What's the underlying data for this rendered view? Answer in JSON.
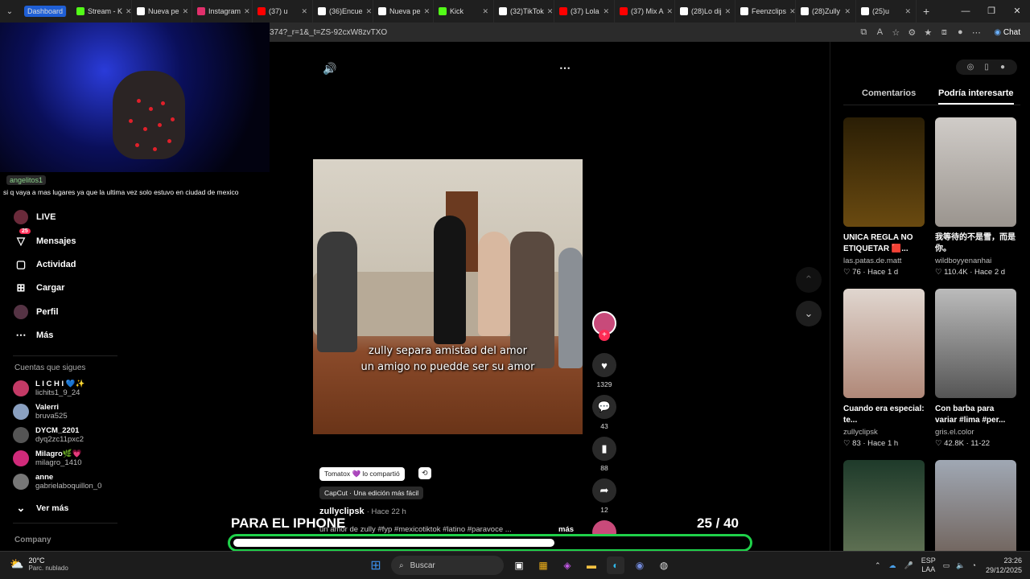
{
  "tabs": [
    {
      "label": "Dashboard",
      "color": "#1f5fd6"
    },
    {
      "label": "Stream - K",
      "color": "#53fc18"
    },
    {
      "label": "Nueva pe",
      "color": "#ffffff"
    },
    {
      "label": "Instagram",
      "color": "#e1306c"
    },
    {
      "label": "(37) u",
      "color": "#ff0000"
    },
    {
      "label": "(36)Encue",
      "color": "#ffffff"
    },
    {
      "label": "Nueva pe",
      "color": "#ffffff"
    },
    {
      "label": "Kick",
      "color": "#53fc18"
    },
    {
      "label": "(32)TikTok",
      "color": "#ffffff"
    },
    {
      "label": "(37) Lola",
      "color": "#ff0000"
    },
    {
      "label": "(37) Mix A",
      "color": "#ff0000"
    },
    {
      "label": "(28)Lo dij",
      "color": "#ffffff"
    },
    {
      "label": "Feenzclips",
      "color": "#ffffff"
    },
    {
      "label": "(28)Zully",
      "color": "#ffffff"
    },
    {
      "label": "(25)u",
      "color": "#ffffff"
    }
  ],
  "address": {
    "url": "374?_r=1&_t=ZS-92cxW8zvTXO",
    "chat_label": "Chat"
  },
  "stream_chat": {
    "user": "angelitos1",
    "message": "si q vaya a mas lugares ya que la ultima vez solo estuvo en ciudad de mexico"
  },
  "sidebar": {
    "nav": [
      {
        "label": "LIVE",
        "icon": "live-icon"
      },
      {
        "label": "Mensajes",
        "icon": "messages-icon",
        "badge": "25"
      },
      {
        "label": "Actividad",
        "icon": "activity-icon"
      },
      {
        "label": "Cargar",
        "icon": "upload-icon"
      },
      {
        "label": "Perfil",
        "icon": "profile-icon"
      },
      {
        "label": "Más",
        "icon": "more-icon"
      }
    ],
    "following_title": "Cuentas que sigues",
    "following": [
      {
        "name": "L I C H I 💙✨",
        "handle": "lichits1_9_24",
        "color": "#c43a66"
      },
      {
        "name": "Valerri",
        "handle": "bruva525",
        "color": "#8aa0c0"
      },
      {
        "name": "DYCM_2201",
        "handle": "dyq2zc11pxc2",
        "color": "#555555"
      },
      {
        "name": "Milagro🌿💗",
        "handle": "milagro_1410",
        "color": "#d02a7a"
      },
      {
        "name": "anne",
        "handle": "gabrielaboquillon_0",
        "color": "#777777"
      }
    ],
    "see_more": "Ver más",
    "company": "Company"
  },
  "video": {
    "subtitle_line1": "zully separa amistad del amor",
    "subtitle_line2": "un amigo no puedde ser su amor",
    "shared_by": "Tomatox 💜 lo compartió",
    "capcut": "CapCut · Una edición más fácil",
    "author": "zullyclipsk",
    "time_ago": "· Hace 22 h",
    "caption": "un amor de zully #fyp #mexicotiktok #latino #paravoce ...",
    "more": "más",
    "likes": "1329",
    "comments": "43",
    "saves": "88",
    "shares": "12"
  },
  "overlay": {
    "title": "PARA EL IPHONE",
    "count": "25",
    "total": "/ 40",
    "progress": 0.625,
    "accent": "#1fd14a"
  },
  "right_panel": {
    "tabs": [
      "Comentarios",
      "Podría interesarte"
    ],
    "cards": [
      {
        "title": "UNICA REGLA NO ETIQUETAR 🟥...",
        "user": "las.patas.de.matt",
        "stats": "♡ 76 · Hace 1 d",
        "thumb": "#3a2a08"
      },
      {
        "title": "我等待的不是雪，而是你。",
        "user": "wildboyyenanhai",
        "stats": "♡ 110.4K · Hace 2 d",
        "thumb": "#b8b2ad"
      },
      {
        "title": "Cuando era especial: te...",
        "user": "zullyclipsk",
        "stats": "♡ 83 · Hace 1 h",
        "thumb": "#c9a79a"
      },
      {
        "title": "Con barba para variar #lima #per...",
        "user": "gris.el.color",
        "stats": "♡ 42.8K · 11-22",
        "thumb": "#9a9a9a"
      },
      {
        "title": "",
        "user": "",
        "stats": "",
        "thumb": "#3b5a40"
      },
      {
        "title": "",
        "user": "",
        "stats": "",
        "thumb": "#8a8f9a"
      }
    ]
  },
  "taskbar": {
    "temp": "20°C",
    "weather": "Parc. nublado",
    "search": "Buscar",
    "lang1": "ESP",
    "lang2": "LAA",
    "time": "23:26",
    "date": "29/12/2025"
  }
}
